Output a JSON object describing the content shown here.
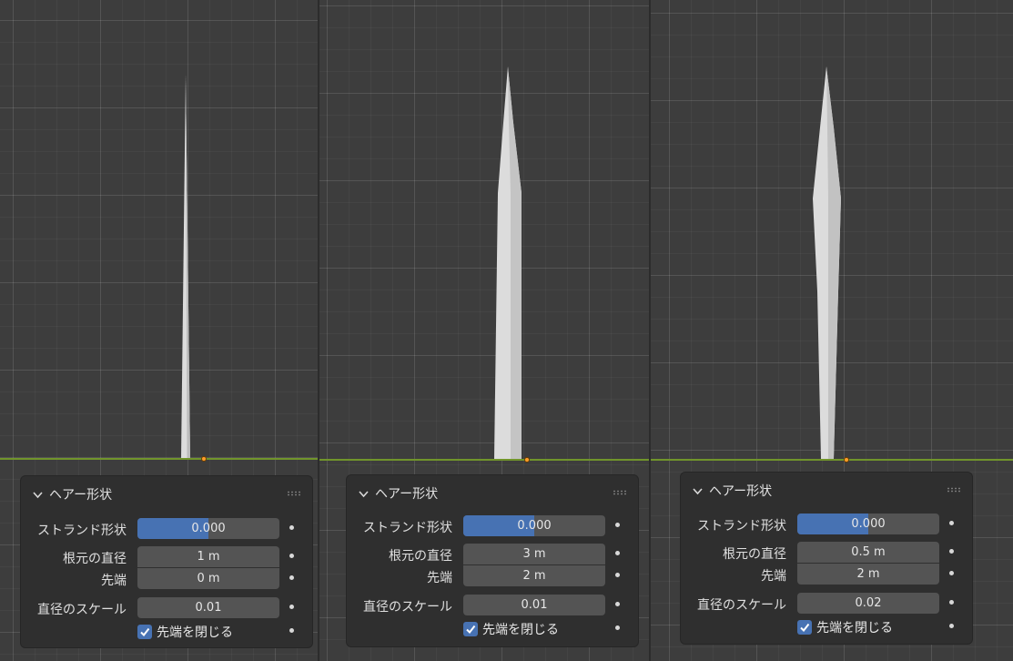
{
  "panels": [
    {
      "title": "ヘアー形状",
      "shape_label": "ストランド形状",
      "shape_value": "0.000",
      "shape_fraction": 0.5,
      "root_label": "根元の直径",
      "root_value": "1 m",
      "tip_label": "先端",
      "tip_value": "0 m",
      "scale_label": "直径のスケール",
      "scale_value": "0.01",
      "close_tip_label": "先端を閉じる",
      "close_tip_checked": true
    },
    {
      "title": "ヘアー形状",
      "shape_label": "ストランド形状",
      "shape_value": "0.000",
      "shape_fraction": 0.5,
      "root_label": "根元の直径",
      "root_value": "3 m",
      "tip_label": "先端",
      "tip_value": "2 m",
      "scale_label": "直径のスケール",
      "scale_value": "0.01",
      "close_tip_label": "先端を閉じる",
      "close_tip_checked": true
    },
    {
      "title": "ヘアー形状",
      "shape_label": "ストランド形状",
      "shape_value": "0.000",
      "shape_fraction": 0.5,
      "root_label": "根元の直径",
      "root_value": "0.5 m",
      "tip_label": "先端",
      "tip_value": "2 m",
      "scale_label": "直径のスケール",
      "scale_value": "0.02",
      "close_tip_label": "先端を閉じる",
      "close_tip_checked": true
    }
  ],
  "colors": {
    "viewport_bg": "#3d3d3d",
    "x_axis": "#71952b",
    "accent": "#4772b3",
    "strand": "#dcdcdc",
    "origin": "#ff9d2c"
  }
}
